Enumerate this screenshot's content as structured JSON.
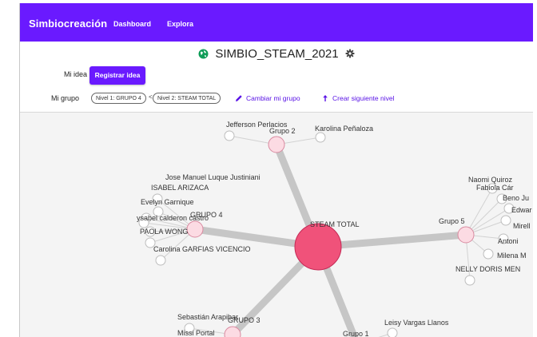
{
  "app": {
    "brand": "Simbiocreación",
    "nav": [
      "Dashboard",
      "Explora"
    ],
    "brand_color": "#6a1aff"
  },
  "header": {
    "title": "SIMBIO_STEAM_2021",
    "globe_icon": "globe-icon",
    "settings_icon": "gear-icon"
  },
  "idea": {
    "label": "Mi idea",
    "button": "Registrar idea"
  },
  "group": {
    "label": "Mi grupo",
    "chips": [
      "Nivel 1: GRUPO 4",
      "Nivel 2: STEAM TOTAL"
    ],
    "separator": "<",
    "change_action": "Cambiar mi grupo",
    "next_level_action": "Crear siguiente nivel",
    "pencil_icon": "pencil-icon",
    "arrow_up_icon": "arrow-up-icon"
  },
  "graph": {
    "center": {
      "label": "STEAM TOTAL",
      "color": "#f0527a"
    },
    "group_color": "#fcdbe3",
    "edge_color": "#c6c6c6",
    "groups": [
      {
        "label": "Grupo 2",
        "members": [
          "Jefferson Perlacios",
          "Karolina Peñaloza"
        ]
      },
      {
        "label": "GRUPO 4",
        "members": [
          "Jose Manuel Luque Justiniani",
          "ISABEL ARIZACA",
          "Evelyn Garnique",
          "ysabel calderon castro",
          "PAOLA WONG",
          "Carolina GARFIAS VICENCIO"
        ]
      },
      {
        "label": "Grupo 5",
        "members": [
          "Naomi Quiroz",
          "Fabiola Cár",
          "Beno Ju",
          "Edwar",
          "Mirell",
          "Antoni",
          "Milena M",
          "NELLY DORIS MEN"
        ]
      },
      {
        "label": "GRUPO 3",
        "members": [
          "Sebastián Arapibar",
          "Missi Portal"
        ]
      },
      {
        "label": "Grupo 1",
        "members": [
          "Leisy Vargas Llanos"
        ]
      }
    ]
  }
}
